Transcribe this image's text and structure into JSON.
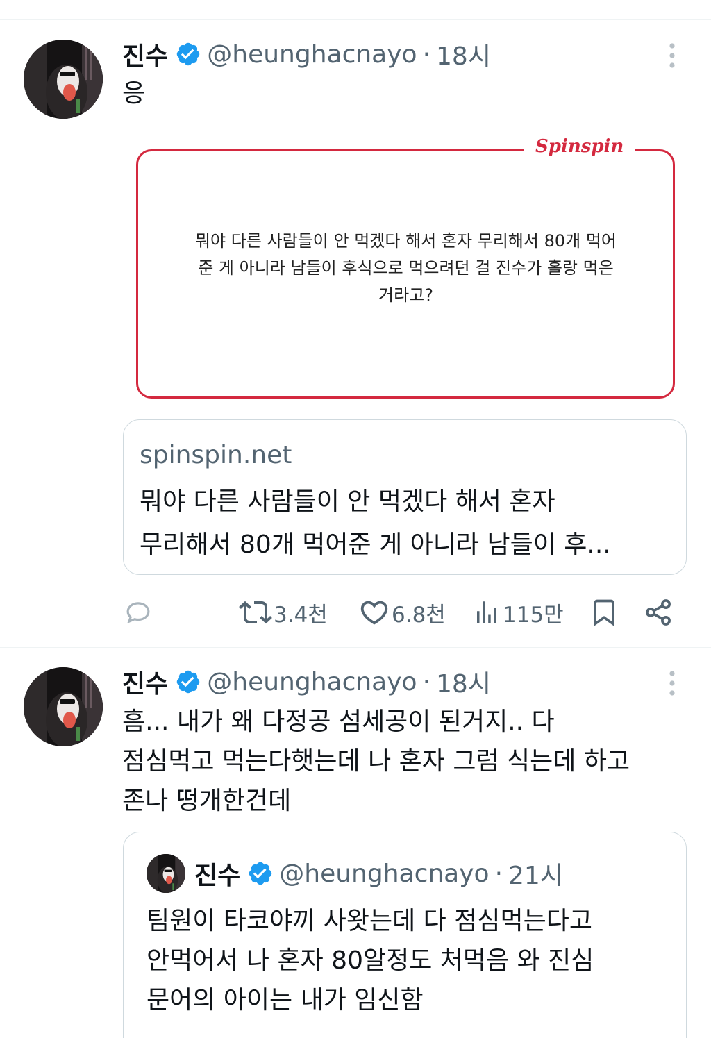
{
  "tweet1": {
    "name": "진수",
    "handle": "@heunghacnayo",
    "separator": "·",
    "time": "18시",
    "text": "응",
    "image": {
      "brand": "Spinspin",
      "text_lines": [
        "뭐야 다른 사람들이 안 먹겠다 해서 혼자 무리해서 80개 먹어",
        "준 게 아니라 남들이 후식으로 먹으려던 걸 진수가 홀랑 먹은",
        "거라고?"
      ]
    },
    "link_card": {
      "domain": "spinspin.net",
      "title_lines": [
        "뭐야 다른 사람들이 안 먹겠다 해서 혼자",
        "무리해서 80개 먹어준 게 아니라 남들이 후..."
      ]
    },
    "actions": {
      "retweets": "3.4천",
      "likes": "6.8천",
      "views": "115만"
    }
  },
  "tweet2": {
    "name": "진수",
    "handle": "@heunghacnayo",
    "separator": "·",
    "time": "18시",
    "text_lines": [
      "흠... 내가 왜 다정공 섬세공이 된거지.. 다",
      "점심먹고 먹는다햇는데 나 혼자 그럼 식는데 하고",
      "존나 떵개한건데"
    ],
    "quote": {
      "name": "진수",
      "handle": "@heunghacnayo",
      "separator": "·",
      "time": "21시",
      "text_lines": [
        "팀원이 타코야끼 사왓는데 다 점심먹는다고",
        "안먹어서 나 혼자 80알정도 처먹음 와 진심",
        "문어의 아이는 내가 임신함"
      ]
    }
  },
  "icons": {
    "verified": "verified-badge-icon",
    "more": "more-vertical-icon",
    "reply": "reply-icon",
    "retweet": "retweet-icon",
    "like": "heart-icon",
    "views": "views-chart-icon",
    "bookmark": "bookmark-icon",
    "share": "share-icon"
  },
  "colors": {
    "verified": "#1d9bf0",
    "brand_red": "#d4293f",
    "text_primary": "#0f1419",
    "text_secondary": "#536471",
    "border": "#cfd9de"
  }
}
